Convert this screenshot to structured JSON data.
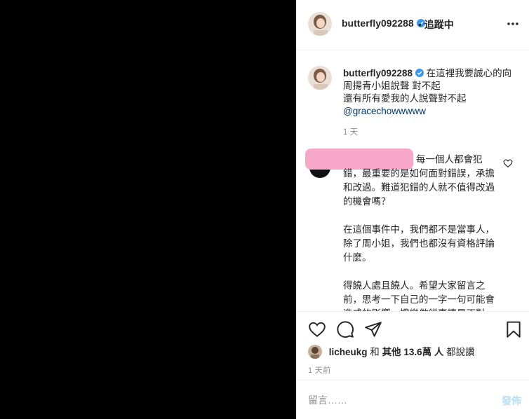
{
  "header": {
    "username": "butterfly092288",
    "separator": "•",
    "follow_status": "追蹤中"
  },
  "caption": {
    "username": "butterfly092288",
    "text_line1": "在這裡我要誠心的向周揚青小姐說聲 對不起",
    "text_line2": "還有所有愛我的人說聲對不起",
    "mention": "@gracechowwwww",
    "time": "1 天"
  },
  "comment": {
    "paragraph1": "每一個人都會犯錯，最重要的是如何面對錯誤，承擔和改過。難道犯錯的人就不值得改過的機會嗎？",
    "paragraph2": "在這個事件中，我們都不是當事人，除了周小姐，我們也都沒有資格評論什麼。",
    "paragraph3": "得饒人處且饒人。希望大家留言之前，思考一下自己的一字一句可能會造成的影響。慣樂做錯事情是不對，但從逃避到面對，這就是大勇"
  },
  "likes": {
    "user": "licheukg",
    "and": "和",
    "others": "其他 13.6萬 人",
    "suffix": "都說讚"
  },
  "posted_time": "1 天前",
  "add_comment": {
    "placeholder": "留言……",
    "post_label": "發佈"
  },
  "colors": {
    "verified": "#3897f0",
    "post_button_disabled": "#b2dffc",
    "redaction": "#f7a8c8"
  }
}
